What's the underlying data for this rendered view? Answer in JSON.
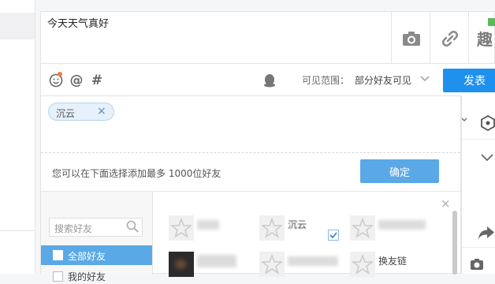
{
  "composer": {
    "text": "今天天气真好",
    "tools": {
      "camera_icon": "camera-icon",
      "link_icon": "link-icon",
      "interest_icon": "interest-icon"
    },
    "interest_label": "趣"
  },
  "toolbar": {
    "emoji_icon": "emoji-icon",
    "at_label": "@",
    "hash_label": "#",
    "visibility_label": "可见范围：",
    "visibility_value": "部分好友可见",
    "publish_label": "发表"
  },
  "picker": {
    "selected": [
      {
        "name": "沉云"
      }
    ],
    "remove_label": "×",
    "hint": "您可以在下面选择添加最多 1000位好友",
    "confirm_label": "确定",
    "search_placeholder": "搜索好友",
    "groups": [
      {
        "label": "全部好友",
        "selected": true
      },
      {
        "label": "我的好友",
        "selected": false
      }
    ],
    "close_label": "×",
    "friends": [
      {
        "name": "沉云",
        "checked": true
      },
      {
        "name": "换友链",
        "checked": false
      }
    ]
  },
  "colors": {
    "accent": "#1e90ee",
    "confirm": "#5aa9e6",
    "chip_bg": "#e6f1fb",
    "notify_dot": "#f07c3a"
  }
}
